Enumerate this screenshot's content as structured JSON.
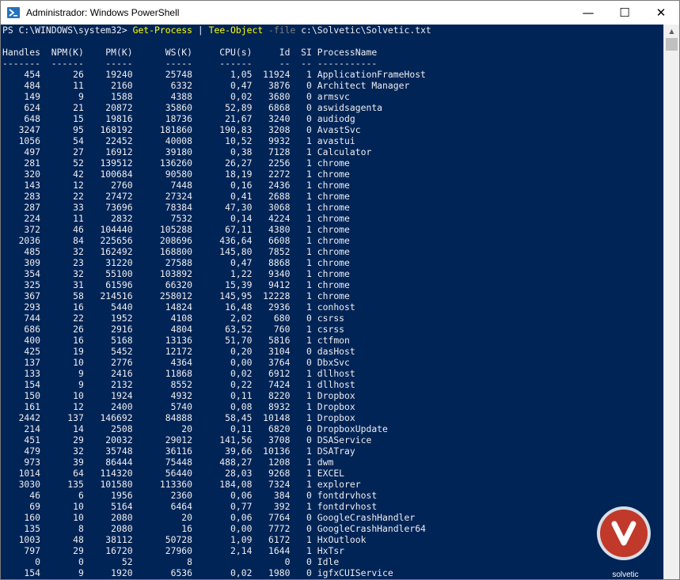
{
  "window": {
    "title": "Administrador: Windows PowerShell",
    "minimize": "—",
    "maximize": "☐",
    "close": "✕"
  },
  "prompt": {
    "path": "PS C:\\WINDOWS\\system32> ",
    "cmd1": "Get-Process",
    "pipe": " | ",
    "cmd2": "Tee-Object",
    "param": " -file ",
    "arg": "c:\\Solvetic\\Solvetic.txt"
  },
  "header": "Handles  NPM(K)    PM(K)      WS(K)     CPU(s)     Id  SI ProcessName",
  "underline": "-------  ------    -----      -----     ------     --  -- -----------",
  "rows": [
    [
      "454",
      "26",
      "19240",
      "25748",
      "1,05",
      "11924",
      "1",
      "ApplicationFrameHost"
    ],
    [
      "484",
      "11",
      "2160",
      "6332",
      "0,47",
      "3876",
      "0",
      "Architect Manager"
    ],
    [
      "149",
      "9",
      "1588",
      "4388",
      "0,02",
      "3680",
      "0",
      "armsvc"
    ],
    [
      "624",
      "21",
      "20872",
      "35860",
      "52,89",
      "6868",
      "0",
      "aswidsagenta"
    ],
    [
      "648",
      "15",
      "19816",
      "18736",
      "21,67",
      "3240",
      "0",
      "audiodg"
    ],
    [
      "3247",
      "95",
      "168192",
      "181860",
      "190,83",
      "3208",
      "0",
      "AvastSvc"
    ],
    [
      "1056",
      "54",
      "22452",
      "40008",
      "10,52",
      "9932",
      "1",
      "avastui"
    ],
    [
      "497",
      "27",
      "16912",
      "39180",
      "0,38",
      "7128",
      "1",
      "Calculator"
    ],
    [
      "281",
      "52",
      "139512",
      "136260",
      "26,27",
      "2256",
      "1",
      "chrome"
    ],
    [
      "320",
      "42",
      "100684",
      "90580",
      "18,19",
      "2272",
      "1",
      "chrome"
    ],
    [
      "143",
      "12",
      "2760",
      "7448",
      "0,16",
      "2436",
      "1",
      "chrome"
    ],
    [
      "283",
      "22",
      "27472",
      "27324",
      "0,41",
      "2688",
      "1",
      "chrome"
    ],
    [
      "287",
      "33",
      "73696",
      "78384",
      "47,30",
      "3068",
      "1",
      "chrome"
    ],
    [
      "224",
      "11",
      "2832",
      "7532",
      "0,14",
      "4224",
      "1",
      "chrome"
    ],
    [
      "372",
      "46",
      "104440",
      "105288",
      "67,11",
      "4380",
      "1",
      "chrome"
    ],
    [
      "2036",
      "84",
      "225656",
      "208696",
      "436,64",
      "6608",
      "1",
      "chrome"
    ],
    [
      "485",
      "32",
      "162492",
      "168800",
      "145,80",
      "7852",
      "1",
      "chrome"
    ],
    [
      "309",
      "23",
      "31220",
      "27588",
      "0,47",
      "8868",
      "1",
      "chrome"
    ],
    [
      "354",
      "32",
      "55100",
      "103892",
      "1,22",
      "9340",
      "1",
      "chrome"
    ],
    [
      "325",
      "31",
      "61596",
      "66320",
      "15,39",
      "9412",
      "1",
      "chrome"
    ],
    [
      "367",
      "58",
      "214516",
      "258012",
      "145,95",
      "12228",
      "1",
      "chrome"
    ],
    [
      "293",
      "16",
      "5440",
      "14824",
      "16,48",
      "2936",
      "1",
      "conhost"
    ],
    [
      "744",
      "22",
      "1952",
      "4108",
      "2,02",
      "680",
      "0",
      "csrss"
    ],
    [
      "686",
      "26",
      "2916",
      "4804",
      "63,52",
      "760",
      "1",
      "csrss"
    ],
    [
      "400",
      "16",
      "5168",
      "13136",
      "51,70",
      "5816",
      "1",
      "ctfmon"
    ],
    [
      "425",
      "19",
      "5452",
      "12172",
      "0,20",
      "3104",
      "0",
      "dasHost"
    ],
    [
      "137",
      "10",
      "2776",
      "4364",
      "0,00",
      "3764",
      "0",
      "DbxSvc"
    ],
    [
      "133",
      "9",
      "2416",
      "11868",
      "0,02",
      "6912",
      "1",
      "dllhost"
    ],
    [
      "154",
      "9",
      "2132",
      "8552",
      "0,22",
      "7424",
      "1",
      "dllhost"
    ],
    [
      "150",
      "10",
      "1924",
      "4932",
      "0,11",
      "8220",
      "1",
      "Dropbox"
    ],
    [
      "161",
      "12",
      "2400",
      "5740",
      "0,08",
      "8932",
      "1",
      "Dropbox"
    ],
    [
      "2442",
      "137",
      "146692",
      "84888",
      "58,45",
      "10148",
      "1",
      "Dropbox"
    ],
    [
      "214",
      "14",
      "2508",
      "20",
      "0,11",
      "6820",
      "0",
      "DropboxUpdate"
    ],
    [
      "451",
      "29",
      "20032",
      "29012",
      "141,56",
      "3708",
      "0",
      "DSAService"
    ],
    [
      "479",
      "32",
      "35748",
      "36116",
      "39,66",
      "10136",
      "1",
      "DSATray"
    ],
    [
      "973",
      "39",
      "86444",
      "75448",
      "488,27",
      "1208",
      "1",
      "dwm"
    ],
    [
      "1014",
      "64",
      "114320",
      "56440",
      "28,03",
      "9268",
      "1",
      "EXCEL"
    ],
    [
      "3030",
      "135",
      "101580",
      "113360",
      "184,08",
      "7324",
      "1",
      "explorer"
    ],
    [
      "46",
      "6",
      "1956",
      "2360",
      "0,06",
      "384",
      "0",
      "fontdrvhost"
    ],
    [
      "69",
      "10",
      "5164",
      "6464",
      "0,77",
      "392",
      "1",
      "fontdrvhost"
    ],
    [
      "160",
      "10",
      "2080",
      "20",
      "0,06",
      "7764",
      "0",
      "GoogleCrashHandler"
    ],
    [
      "135",
      "8",
      "2080",
      "16",
      "0,00",
      "7772",
      "0",
      "GoogleCrashHandler64"
    ],
    [
      "1003",
      "48",
      "38112",
      "50728",
      "1,09",
      "6172",
      "1",
      "HxOutlook"
    ],
    [
      "797",
      "29",
      "16720",
      "27960",
      "2,14",
      "1644",
      "1",
      "HxTsr"
    ],
    [
      "0",
      "0",
      "52",
      "8",
      "",
      "0",
      "0",
      "Idle"
    ],
    [
      "154",
      "9",
      "1920",
      "6536",
      "0,02",
      "1980",
      "0",
      "igfxCUIService"
    ]
  ],
  "watermark": {
    "text": "solvetic"
  },
  "colors": {
    "console_bg": "#012456",
    "console_text": "#eeedf0",
    "command": "#ffff00",
    "parameter": "#808080"
  }
}
